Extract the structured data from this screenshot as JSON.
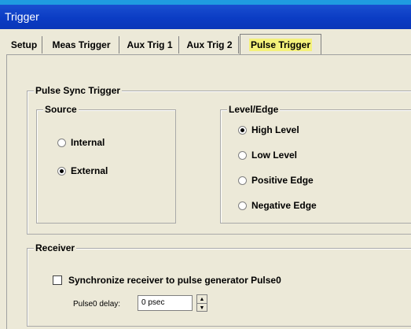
{
  "window": {
    "title": "Trigger"
  },
  "tabs": [
    {
      "label": "Setup"
    },
    {
      "label": "Meas Trigger"
    },
    {
      "label": "Aux Trig 1"
    },
    {
      "label": "Aux Trig 2"
    },
    {
      "label": "Pulse Trigger"
    }
  ],
  "active_tab": "Pulse Trigger",
  "pulse_sync": {
    "title": "Pulse Sync Trigger",
    "source": {
      "title": "Source",
      "options": [
        {
          "label": "Internal",
          "selected": false
        },
        {
          "label": "External",
          "selected": true
        }
      ]
    },
    "level_edge": {
      "title": "Level/Edge",
      "options": [
        {
          "label": "High Level",
          "selected": true
        },
        {
          "label": "Low Level",
          "selected": false
        },
        {
          "label": "Positive Edge",
          "selected": false
        },
        {
          "label": "Negative Edge",
          "selected": false
        }
      ]
    }
  },
  "receiver": {
    "title": "Receiver",
    "sync_checkbox_label": "Synchronize receiver to pulse generator Pulse0",
    "sync_checked": false,
    "delay_label": "Pulse0 delay:",
    "delay_value": "0 psec"
  },
  "colors": {
    "titlebar": "#0b3cc4",
    "topstrip": "#1f9be0",
    "active_tab_highlight": "#f4f17a",
    "background": "#ece9d8"
  }
}
